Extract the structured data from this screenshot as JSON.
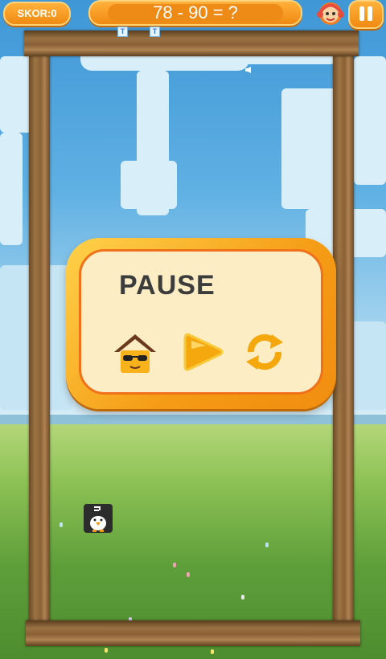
{
  "hud": {
    "score_label": "SKOR:0",
    "question": "78 - 90 = ?",
    "avatar_icon": "player-avatar-icon",
    "pause_icon": "pause-icon"
  },
  "dialog": {
    "title": "PAUSE",
    "buttons": [
      {
        "name": "home-button",
        "icon": "home-icon"
      },
      {
        "name": "resume-button",
        "icon": "play-icon"
      },
      {
        "name": "restart-button",
        "icon": "restart-icon"
      }
    ]
  },
  "colors": {
    "accent_orange": "#f59b15",
    "panel_fill": "#fdedc4",
    "panel_border": "#f0711a",
    "sky": "#5aa8dc",
    "grass": "#6aa840"
  }
}
